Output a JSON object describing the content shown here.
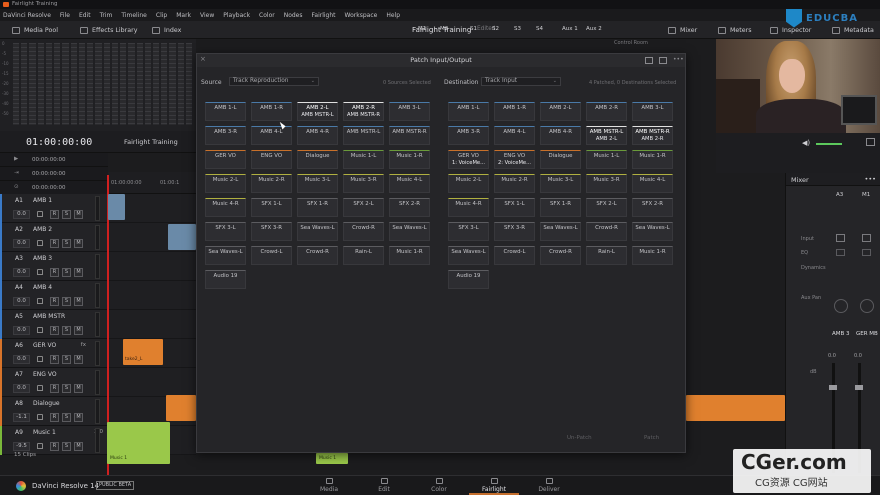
{
  "window": {
    "title": "Fairlight Training"
  },
  "menu": [
    "DaVinci Resolve",
    "File",
    "Edit",
    "Trim",
    "Timeline",
    "Clip",
    "Mark",
    "View",
    "Playback",
    "Color",
    "Nodes",
    "Fairlight",
    "Workspace",
    "Help"
  ],
  "toolbar": {
    "media_pool": "Media Pool",
    "effects_library": "Effects Library",
    "index": "Index",
    "project_title": "Fairlight Training",
    "project_status": "Edited",
    "buses": [
      "M1",
      "M2",
      "S1",
      "S2",
      "S3",
      "S4",
      "Aux 1",
      "Aux 2"
    ],
    "control_room": "Control Room",
    "mixer": "Mixer",
    "meters": "Meters",
    "inspector": "Inspector",
    "metadata": "Metadata"
  },
  "meters_scale": [
    "0",
    "-5",
    "-10",
    "-15",
    "-20",
    "-30",
    "-40",
    "-50"
  ],
  "timeline": {
    "timecode": "01:00:00:00",
    "name": "Fairlight Training",
    "sub_timecodes": [
      "00:00:00:00",
      "00:00:00:00",
      "00:00:00:00"
    ],
    "ruler": [
      "01:00:00:00",
      "01:00:1"
    ],
    "clip_count": "15 Clips"
  },
  "tracks": [
    {
      "id": "A1",
      "name": "AMB 1",
      "value": "0.0",
      "fx": "",
      "db": "",
      "color": "#3a7ac8"
    },
    {
      "id": "A2",
      "name": "AMB 2",
      "value": "0.0",
      "fx": "",
      "db": "",
      "color": "#3a7ac8"
    },
    {
      "id": "A3",
      "name": "AMB 3",
      "value": "0.0",
      "fx": "",
      "db": "",
      "color": "#3a7ac8"
    },
    {
      "id": "A4",
      "name": "AMB 4",
      "value": "0.0",
      "fx": "",
      "db": "",
      "color": "#3a7ac8"
    },
    {
      "id": "A5",
      "name": "AMB MSTR",
      "value": "0.0",
      "fx": "",
      "db": "",
      "color": "#3a7ac8"
    },
    {
      "id": "A6",
      "name": "GER VO",
      "value": "0.0",
      "fx": "fx",
      "db": "",
      "color": "#d8742a"
    },
    {
      "id": "A7",
      "name": "ENG VO",
      "value": "0.0",
      "fx": "",
      "db": "",
      "color": "#d8742a"
    },
    {
      "id": "A8",
      "name": "Dialogue",
      "value": "-1.1",
      "fx": "",
      "db": "",
      "color": "#d8742a"
    },
    {
      "id": "A9",
      "name": "Music 1",
      "value": "-9.5",
      "fx": "",
      "db": "2.0",
      "color": "#7ab83a"
    }
  ],
  "clips": {
    "take2": "take2_L",
    "music": "Music 1",
    "music2": "Music 1"
  },
  "track_buttons": [
    "R",
    "S",
    "M"
  ],
  "dialog": {
    "title": "Patch Input/Output",
    "source_label": "Source",
    "source_select": "Track Reproduction",
    "source_count": "0 Sources Selected",
    "dest_label": "Destination",
    "dest_select": "Track Input",
    "dest_count": "4 Patched, 0 Destinations Selected",
    "unpatch": "Un-Patch",
    "patch": "Patch",
    "source_items": [
      {
        "l1": "AMB 1-L",
        "l2": "",
        "c": "blue"
      },
      {
        "l1": "AMB 1-R",
        "l2": "",
        "c": "blue"
      },
      {
        "l1": "AMB 2-L",
        "l2": "AMB MSTR-L",
        "c": "sel"
      },
      {
        "l1": "AMB 2-R",
        "l2": "AMB MSTR-R",
        "c": "sel"
      },
      {
        "l1": "AMB 3-L",
        "l2": "",
        "c": "blue"
      },
      {
        "l1": "AMB 3-R",
        "l2": "",
        "c": "blue"
      },
      {
        "l1": "AMB 4-L",
        "l2": "",
        "c": "blue"
      },
      {
        "l1": "AMB 4-R",
        "l2": "",
        "c": "blue"
      },
      {
        "l1": "AMB MSTR-L",
        "l2": "",
        "c": "blue"
      },
      {
        "l1": "AMB MSTR-R",
        "l2": "",
        "c": "blue"
      },
      {
        "l1": "GER VO",
        "l2": "",
        "c": "orange"
      },
      {
        "l1": "ENG VO",
        "l2": "",
        "c": "orange"
      },
      {
        "l1": "Dialogue",
        "l2": "",
        "c": "orange"
      },
      {
        "l1": "Music 1-L",
        "l2": "",
        "c": "green"
      },
      {
        "l1": "Music 1-R",
        "l2": "",
        "c": "green"
      },
      {
        "l1": "Music 2-L",
        "l2": "",
        "c": "greenb"
      },
      {
        "l1": "Music 2-R",
        "l2": "",
        "c": "greenb"
      },
      {
        "l1": "Music 3-L",
        "l2": "",
        "c": "greenb"
      },
      {
        "l1": "Music 3-R",
        "l2": "",
        "c": "greenb"
      },
      {
        "l1": "Music 4-L",
        "l2": "",
        "c": "greenb"
      },
      {
        "l1": "Music 4-R",
        "l2": "",
        "c": "greenb"
      },
      {
        "l1": "SFX 1-L",
        "l2": "",
        "c": ""
      },
      {
        "l1": "SFX 1-R",
        "l2": "",
        "c": ""
      },
      {
        "l1": "SFX 2-L",
        "l2": "",
        "c": ""
      },
      {
        "l1": "SFX 2-R",
        "l2": "",
        "c": ""
      },
      {
        "l1": "SFX 3-L",
        "l2": "",
        "c": ""
      },
      {
        "l1": "SFX 3-R",
        "l2": "",
        "c": ""
      },
      {
        "l1": "Sea Waves-L",
        "l2": "",
        "c": ""
      },
      {
        "l1": "Crowd-R",
        "l2": "",
        "c": ""
      },
      {
        "l1": "Sea Waves-L",
        "l2": "",
        "c": ""
      },
      {
        "l1": "Sea Waves-L",
        "l2": "",
        "c": ""
      },
      {
        "l1": "Crowd-L",
        "l2": "",
        "c": ""
      },
      {
        "l1": "Crowd-R",
        "l2": "",
        "c": ""
      },
      {
        "l1": "Rain-L",
        "l2": "",
        "c": ""
      },
      {
        "l1": "Music 1-R",
        "l2": "",
        "c": ""
      },
      {
        "l1": "Audio 19",
        "l2": "",
        "c": ""
      }
    ],
    "dest_items": [
      {
        "l1": "AMB 1-L",
        "l2": "",
        "c": "blue"
      },
      {
        "l1": "AMB 1-R",
        "l2": "",
        "c": "blue"
      },
      {
        "l1": "AMB 2-L",
        "l2": "",
        "c": "blue"
      },
      {
        "l1": "AMB 2-R",
        "l2": "",
        "c": "blue"
      },
      {
        "l1": "AMB 3-L",
        "l2": "",
        "c": "blue"
      },
      {
        "l1": "AMB 3-R",
        "l2": "",
        "c": "blue"
      },
      {
        "l1": "AMB 4-L",
        "l2": "",
        "c": "blue"
      },
      {
        "l1": "AMB 4-R",
        "l2": "",
        "c": "blue"
      },
      {
        "l1": "AMB MSTR-L",
        "l2": "AMB 2-L",
        "c": "sel"
      },
      {
        "l1": "AMB MSTR-R",
        "l2": "AMB 2-R",
        "c": "sel"
      },
      {
        "l1": "GER VO",
        "l2": "1: VoiceMe...",
        "c": "orange"
      },
      {
        "l1": "ENG VO",
        "l2": "2: VoiceMe...",
        "c": "orange"
      },
      {
        "l1": "Dialogue",
        "l2": "",
        "c": "orange"
      },
      {
        "l1": "Music 1-L",
        "l2": "",
        "c": "green"
      },
      {
        "l1": "Music 1-R",
        "l2": "",
        "c": "green"
      },
      {
        "l1": "Music 2-L",
        "l2": "",
        "c": "greenb"
      },
      {
        "l1": "Music 2-R",
        "l2": "",
        "c": "greenb"
      },
      {
        "l1": "Music 3-L",
        "l2": "",
        "c": "greenb"
      },
      {
        "l1": "Music 3-R",
        "l2": "",
        "c": "greenb"
      },
      {
        "l1": "Music 4-L",
        "l2": "",
        "c": "greenb"
      },
      {
        "l1": "Music 4-R",
        "l2": "",
        "c": "greenb"
      },
      {
        "l1": "SFX 1-L",
        "l2": "",
        "c": ""
      },
      {
        "l1": "SFX 1-R",
        "l2": "",
        "c": ""
      },
      {
        "l1": "SFX 2-L",
        "l2": "",
        "c": ""
      },
      {
        "l1": "SFX 2-R",
        "l2": "",
        "c": ""
      },
      {
        "l1": "SFX 3-L",
        "l2": "",
        "c": ""
      },
      {
        "l1": "SFX 3-R",
        "l2": "",
        "c": ""
      },
      {
        "l1": "Sea Waves-L",
        "l2": "",
        "c": ""
      },
      {
        "l1": "Crowd-R",
        "l2": "",
        "c": ""
      },
      {
        "l1": "Sea Waves-L",
        "l2": "",
        "c": ""
      },
      {
        "l1": "Sea Waves-L",
        "l2": "",
        "c": ""
      },
      {
        "l1": "Crowd-L",
        "l2": "",
        "c": ""
      },
      {
        "l1": "Crowd-R",
        "l2": "",
        "c": ""
      },
      {
        "l1": "Rain-L",
        "l2": "",
        "c": ""
      },
      {
        "l1": "Music 1-R",
        "l2": "",
        "c": ""
      },
      {
        "l1": "Audio 19",
        "l2": "",
        "c": ""
      }
    ]
  },
  "mixer": {
    "title": "Mixer",
    "channels": [
      "A3",
      "M1"
    ],
    "labels": [
      "Input",
      "EQ",
      "Dynamics",
      "Aux Pan"
    ],
    "strip_names": [
      "AMB 3",
      "GER MB"
    ],
    "db_label": "dB",
    "levels": [
      "0.0",
      "0.0"
    ]
  },
  "pages": {
    "app_name": "DaVinci Resolve 14",
    "badge": "PUBLIC BETA",
    "tabs": [
      "Media",
      "Edit",
      "Color",
      "Fairlight",
      "Deliver"
    ],
    "active": "Fairlight"
  },
  "brand": {
    "logo_text": "EDUCBA"
  },
  "watermark": {
    "big": "CGer.com",
    "small": "CG资源 CG网站"
  }
}
